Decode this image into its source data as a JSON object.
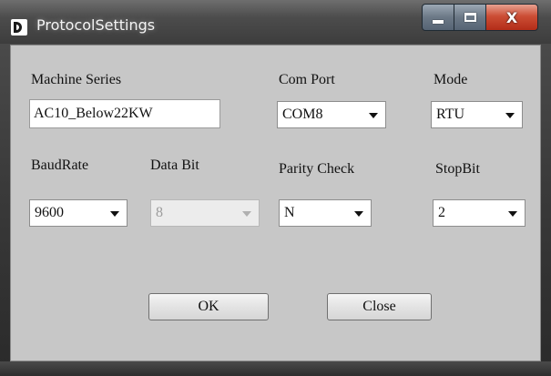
{
  "window": {
    "title": "ProtocolSettings",
    "caption_buttons": {
      "minimize": "minimize",
      "maximize": "maximize",
      "close": "X"
    }
  },
  "fields": {
    "machine_series": {
      "label": "Machine Series",
      "value": "AC10_Below22KW"
    },
    "com_port": {
      "label": "Com Port",
      "value": "COM8"
    },
    "mode": {
      "label": "Mode",
      "value": "RTU"
    },
    "baud_rate": {
      "label": "BaudRate",
      "value": "9600"
    },
    "data_bit": {
      "label": "Data Bit",
      "value": "8",
      "enabled": false
    },
    "parity_check": {
      "label": "Parity Check",
      "value": "N"
    },
    "stop_bit": {
      "label": "StopBit",
      "value": "2"
    }
  },
  "buttons": {
    "ok": "OK",
    "close": "Close"
  },
  "colors": {
    "client_bg": "#c7c7c7",
    "close_button": "#c8432b"
  }
}
